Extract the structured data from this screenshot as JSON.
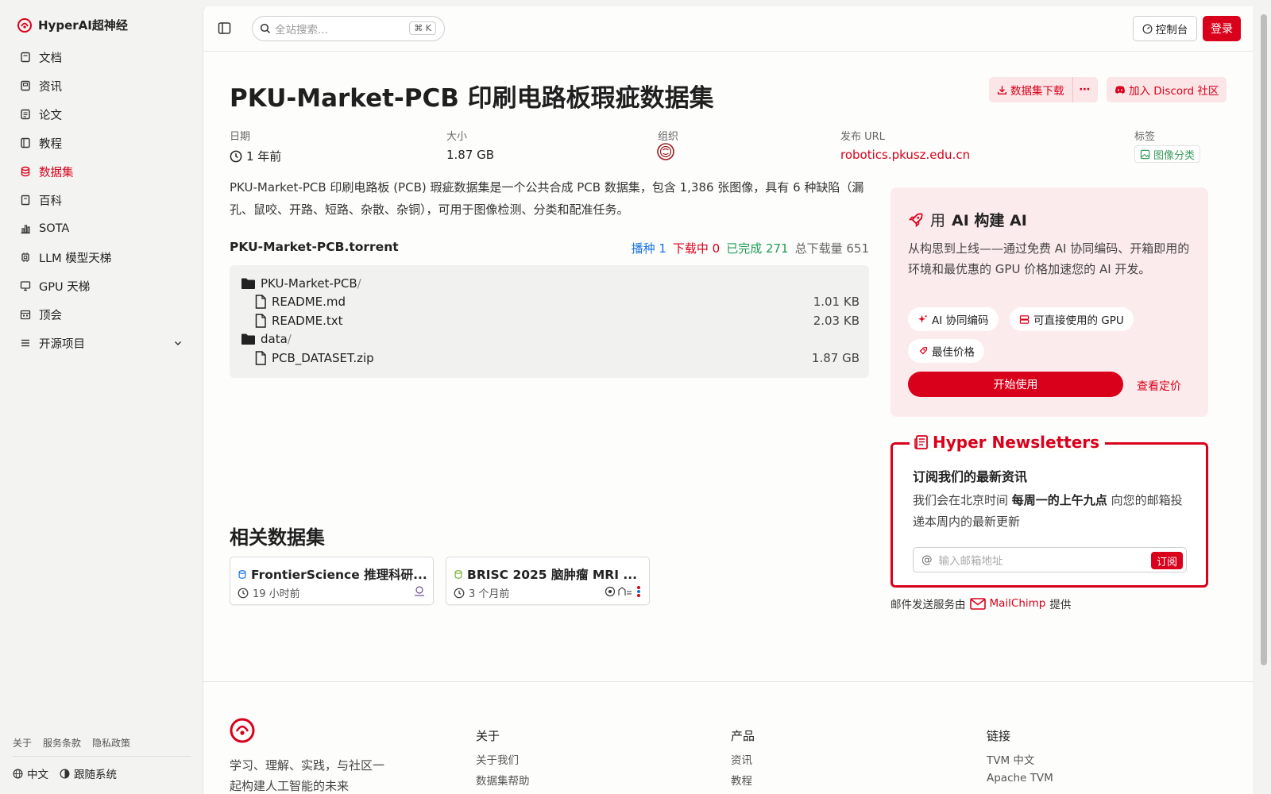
{
  "brand": {
    "name": "HyperAI超神经"
  },
  "nav": {
    "items": [
      {
        "label": "文档",
        "icon": "book-icon"
      },
      {
        "label": "资讯",
        "icon": "news-icon"
      },
      {
        "label": "论文",
        "icon": "paper-icon"
      },
      {
        "label": "教程",
        "icon": "tutorial-icon"
      },
      {
        "label": "数据集",
        "icon": "database-icon"
      },
      {
        "label": "百科",
        "icon": "wiki-icon"
      },
      {
        "label": "SOTA",
        "icon": "chart-icon"
      },
      {
        "label": "LLM 模型天梯",
        "icon": "chip-icon"
      },
      {
        "label": "GPU 天梯",
        "icon": "monitor-icon"
      },
      {
        "label": "顶会",
        "icon": "calendar-icon"
      },
      {
        "label": "开源项目",
        "icon": "list-icon"
      }
    ],
    "active": "数据集"
  },
  "sidebar_links": [
    "关于",
    "服务条款",
    "隐私政策"
  ],
  "sidebar_bottom": {
    "language": "中文",
    "theme": "跟随系统"
  },
  "topbar": {
    "search_placeholder": "全站搜索...",
    "search_shortcut": "K",
    "console_label": "控制台",
    "login_label": "登录"
  },
  "dataset": {
    "title": "PKU-Market-PCB 印刷电路板瑕疵数据集",
    "download_label": "数据集下载",
    "more_label": "⋯",
    "discord_label": "加入 Discord 社区",
    "meta": {
      "date_label": "日期",
      "date_value": "1 年前",
      "size_label": "大小",
      "size_value": "1.87 GB",
      "org_label": "组织",
      "url_label": "发布 URL",
      "url_value": "robotics.pkusz.edu.cn",
      "tags_label": "标签",
      "tag_value": "图像分类"
    },
    "description": "PKU-Market-PCB 印刷电路板 (PCB) 瑕疵数据集是一个公共合成 PCB 数据集，包含 1,386 张图像，具有 6 种缺陷（漏孔、鼠咬、开路、短路、杂散、杂铜），可用于图像检测、分类和配准任务。"
  },
  "torrent": {
    "name": "PKU-Market-PCB.torrent",
    "stats": {
      "seed": "播种 1",
      "downloading": "下载中 0",
      "completed": "已完成 271",
      "total": "总下载量 651"
    },
    "files": [
      {
        "name": "PKU-Market-PCB",
        "suffix": "/",
        "type": "folder",
        "size": ""
      },
      {
        "name": "README.md",
        "suffix": "",
        "type": "file",
        "size": "1.01 KB"
      },
      {
        "name": "README.txt",
        "suffix": "",
        "type": "file",
        "size": "2.03 KB"
      },
      {
        "name": "data",
        "suffix": "/",
        "type": "folder",
        "size": ""
      },
      {
        "name": "PCB_DATASET.zip",
        "suffix": "",
        "type": "file",
        "size": "1.87 GB"
      }
    ]
  },
  "related": {
    "title": "相关数据集",
    "items": [
      {
        "title": "FrontierScience 推理科研...",
        "time": "19 小时前"
      },
      {
        "title": "BRISC 2025 脑肿瘤 MRI ...",
        "time": "3 个月前"
      }
    ]
  },
  "ai_card": {
    "title_prefix": "用",
    "title_bold": "AI 构建 AI",
    "description": "从构思到上线——通过免费 AI 协同编码、开箱即用的环境和最优惠的 GPU 价格加速您的 AI 开发。",
    "chips": [
      "AI 协同编码",
      "可直接使用的 GPU",
      "最佳价格"
    ],
    "start_label": "开始使用",
    "pricing_label": "查看定价"
  },
  "newsletter": {
    "legend": "Hyper Newsletters",
    "heading": "订阅我们的最新资讯",
    "text_before": "我们会在北京时间",
    "text_bold": "每周一的上午九点",
    "text_after": "向您的邮箱投递本周内的最新更新",
    "email_placeholder": "输入邮箱地址",
    "subscribe_label": "订阅",
    "footer_prefix": "邮件发送服务由",
    "provider": "MailChimp",
    "footer_suffix": "提供"
  },
  "footer": {
    "tagline": "学习、理解、实践，与社区一起构建人工智能的未来",
    "columns": [
      {
        "title": "关于",
        "links": [
          "关于我们",
          "数据集帮助"
        ]
      },
      {
        "title": "产品",
        "links": [
          "资讯",
          "教程"
        ]
      },
      {
        "title": "链接",
        "links": [
          "TVM 中文",
          "Apache TVM"
        ]
      }
    ]
  },
  "colors": {
    "accent": "#d9001b",
    "seed": "#1a73e8",
    "downloading": "#d9001b",
    "completed": "#1f9d55",
    "total": "#666666"
  }
}
